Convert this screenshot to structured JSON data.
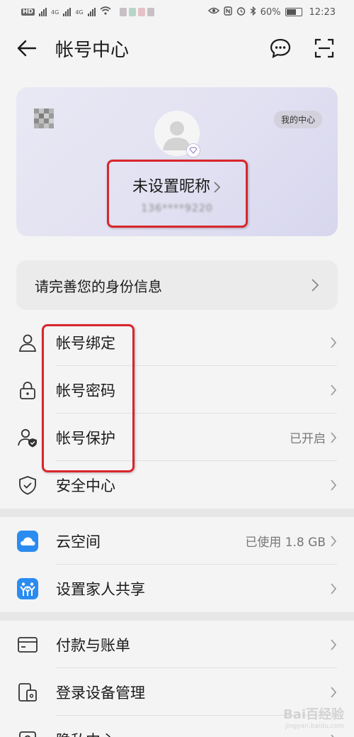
{
  "status_bar": {
    "network_tags": [
      "HD",
      "4G",
      "4G"
    ],
    "battery": "60%",
    "time": "12:23"
  },
  "header": {
    "title": "帐号中心"
  },
  "profile": {
    "my_center_label": "我的中心",
    "nickname": "未设置昵称",
    "phone_masked": "136****9220"
  },
  "identity_banner": {
    "label": "请完善您的身份信息"
  },
  "security_group": [
    {
      "label": "帐号绑定",
      "icon": "person-icon",
      "value": ""
    },
    {
      "label": "帐号密码",
      "icon": "lock-icon",
      "value": ""
    },
    {
      "label": "帐号保护",
      "icon": "person-shield-icon",
      "value": "已开启"
    },
    {
      "label": "安全中心",
      "icon": "shield-icon",
      "value": ""
    }
  ],
  "cloud_group": [
    {
      "label": "云空间",
      "icon": "cloud-icon",
      "value": "已使用 1.8 GB"
    },
    {
      "label": "设置家人共享",
      "icon": "family-icon",
      "value": ""
    }
  ],
  "other_group": [
    {
      "label": "付款与账单",
      "icon": "card-icon",
      "value": ""
    },
    {
      "label": "登录设备管理",
      "icon": "devices-icon",
      "value": ""
    },
    {
      "label": "隐私中心",
      "icon": "privacy-icon",
      "value": ""
    }
  ],
  "watermark": {
    "text": "Bai百经验",
    "sub": "jingyan.baidu.com"
  },
  "colors": {
    "highlight": "#d9262b",
    "cloud_blue": "#2a8cf0",
    "profile_card": "#e2e1f2"
  }
}
